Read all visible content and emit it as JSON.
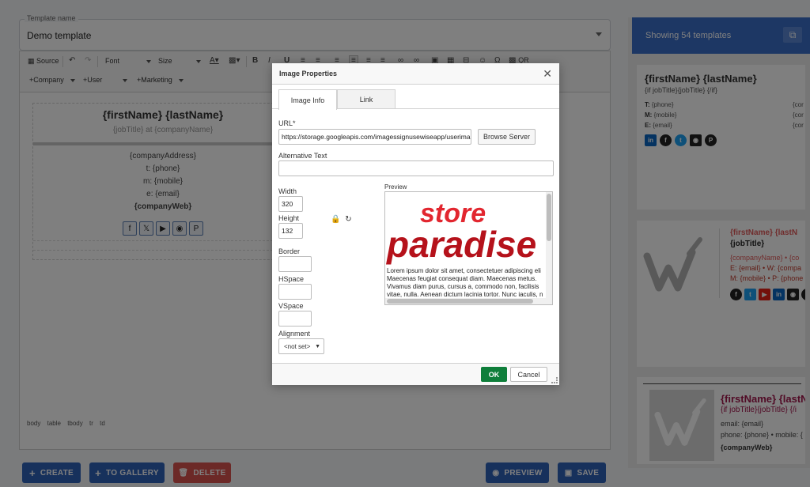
{
  "template_name": {
    "legend": "Template name",
    "value": "Demo template"
  },
  "toolbar": {
    "source": "Source",
    "font": "Font",
    "size": "Size",
    "bold": "B",
    "italic": "I",
    "underline": "U",
    "qr": "QR",
    "company": "+Company",
    "user": "+User",
    "marketing": "+Marketing"
  },
  "signature": {
    "name": "{firstName} {lastName}",
    "title": "{jobTitle} at {companyName}",
    "address": "{companyAddress}",
    "phone": "t: {phone}",
    "mobile": "m: {mobile}",
    "email": "e: {email}",
    "web": "{companyWeb}"
  },
  "pathbar": [
    "body",
    "table",
    "tbody",
    "tr",
    "td"
  ],
  "actions": {
    "create": "CREATE",
    "to_gallery": "TO GALLERY",
    "delete": "DELETE",
    "preview": "PREVIEW",
    "save": "SAVE"
  },
  "gallery": {
    "header": "Showing 54 templates",
    "card1": {
      "name": "{firstName} {lastName}",
      "title": "{if jobTitle}{jobTitle} {/if}",
      "phone_label": "T:",
      "phone": "{phone}",
      "mobile_label": "M:",
      "mobile": "{mobile}",
      "email_label": "E:",
      "email": "{email}",
      "right1": "{cor",
      "right2": "{cor",
      "right3": "{cor"
    },
    "card2": {
      "name": "{firstName} {lastN",
      "title": "{jobTitle}",
      "company": "{companyName} • {co",
      "email": "E: {email} • W: {compa",
      "mobile": "M: {mobile} • P: {phone"
    },
    "card3": {
      "name": "{firstName} {lastN",
      "title": "{if jobTitle}{jobTitle} {/i",
      "email": "email: {email}",
      "phone": "phone: {phone} • mobile: {",
      "web": "{companyWeb}"
    }
  },
  "dialog": {
    "title": "Image Properties",
    "tab_image_info": "Image Info",
    "tab_link": "Link",
    "url_label": "URL*",
    "url_value": "https://storage.googleapis.com/imagessignusewiseapp/userimag",
    "browse_server": "Browse Server",
    "alt_label": "Alternative Text",
    "alt_value": "",
    "width_label": "Width",
    "width_value": "320",
    "height_label": "Height",
    "height_value": "132",
    "border_label": "Border",
    "hspace_label": "HSpace",
    "vspace_label": "VSpace",
    "alignment_label": "Alignment",
    "alignment_value": "<not set>",
    "preview_label": "Preview",
    "preview_logo_top": "store",
    "preview_logo_bottom": "paradise",
    "preview_text": [
      "Lorem ipsum dolor sit amet, consectetuer adipiscing eli",
      "Maecenas feugiat consequat diam. Maecenas metus.",
      "Vivamus diam purus, cursus a, commodo non, facilisis",
      "vitae, nulla. Aenean dictum lacinia tortor. Nunc iaculis, n"
    ],
    "ok": "OK",
    "cancel": "Cancel"
  },
  "colors": {
    "accent_blue": "#3b6fc9",
    "ok_green": "#0e7e3a",
    "delete_red": "#d9534f",
    "logo_red": "#e2262f",
    "logo_darkred": "#b5121b"
  }
}
